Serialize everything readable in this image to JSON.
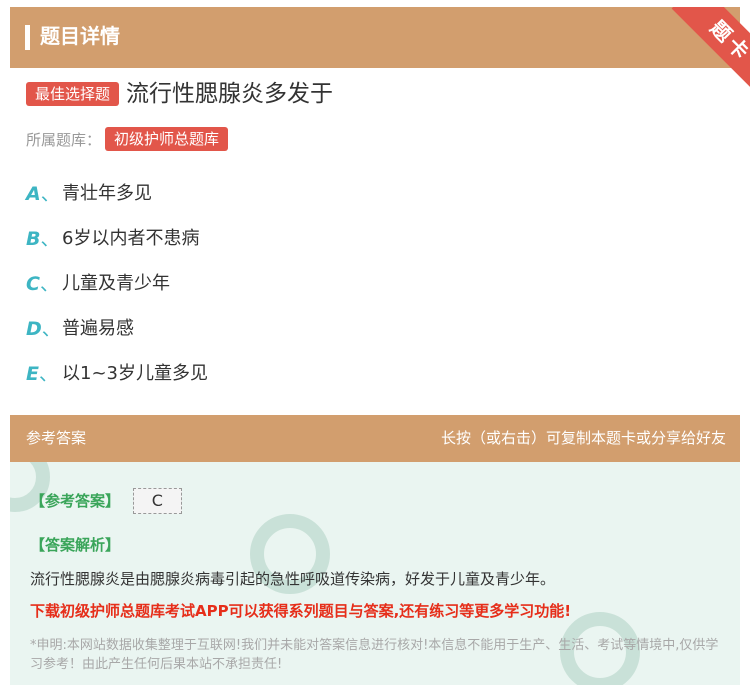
{
  "header": {
    "title": "题目详情",
    "corner_label": "题卡"
  },
  "question": {
    "type_badge": "最佳选择题",
    "text": "流行性腮腺炎多发于",
    "bank_label": "所属题库：",
    "bank_name": "初级护师总题库"
  },
  "options": [
    {
      "letter": "A",
      "sep": "、",
      "text": "青壮年多见"
    },
    {
      "letter": "B",
      "sep": "、",
      "text": "6岁以内者不患病"
    },
    {
      "letter": "C",
      "sep": "、",
      "text": "儿童及青少年"
    },
    {
      "letter": "D",
      "sep": "、",
      "text": "普遍易感"
    },
    {
      "letter": "E",
      "sep": "、",
      "text": "以1~3岁儿童多见"
    }
  ],
  "answer_section": {
    "title": "参考答案",
    "tip": "长按（或右击）可复制本题卡或分享给好友",
    "answer_tag": "【参考答案】",
    "answer_value": "C",
    "explain_tag": "【答案解析】",
    "explanation": "流行性腮腺炎是由腮腺炎病毒引起的急性呼吸道传染病，好发于儿童及青少年。",
    "promo": "下载初级护师总题库考试APP可以获得系列题目与答案,还有练习等更多学习功能!",
    "disclaimer": "*申明:本网站数据收集整理于互联网!我们并未能对答案信息进行核对!本信息不能用于生产、生活、考试等情境中,仅供学习参考！由此产生任何后果本站不承担责任!"
  },
  "colors": {
    "header_bg": "#d29e6e",
    "badge_red": "#e2564a",
    "option_letter": "#3db5c3",
    "answer_bg": "#eaf5f1",
    "green_tag": "#3aa55a",
    "promo_red": "#e62e1a"
  }
}
